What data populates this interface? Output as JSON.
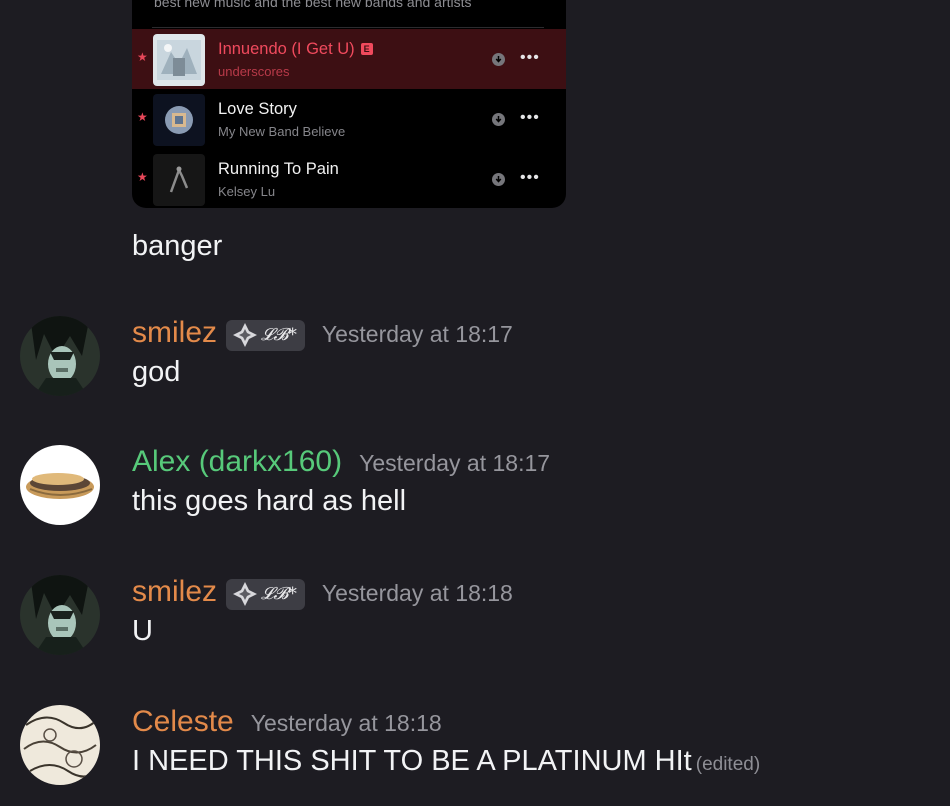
{
  "embed": {
    "description": "best new music and the best new bands and artists",
    "tracks": [
      {
        "title": "Innuendo (I Get U)",
        "artist": "underscores",
        "explicit": "E",
        "highlighted": true
      },
      {
        "title": "Love Story",
        "artist": "My New Band Believe",
        "highlighted": false
      },
      {
        "title": "Running To Pain",
        "artist": "Kelsey Lu",
        "highlighted": false
      }
    ],
    "icons": [
      "star-icon",
      "download-icon",
      "more-options-icon"
    ],
    "star_glyph": "★",
    "more_glyph": "•••"
  },
  "continuation_text": "banger",
  "messages": [
    {
      "username": "smilez",
      "username_color": "#e38a4a",
      "role_tag": "𝓛𝓑*",
      "timestamp": "Yesterday at 18:17",
      "text": "god"
    },
    {
      "username": "Alex (darkx160)",
      "username_color": "#57c97a",
      "timestamp": "Yesterday at 18:17",
      "text": "this goes hard as hell"
    },
    {
      "username": "smilez",
      "username_color": "#e38a4a",
      "role_tag": "𝓛𝓑*",
      "timestamp": "Yesterday at 18:18",
      "text": "U"
    },
    {
      "username": "Celeste",
      "username_color": "#e38a4a",
      "timestamp": "Yesterday at 18:18",
      "text": "I NEED THIS SHIT TO BE A PLATINUM HIt",
      "edited_label": "(edited)"
    }
  ]
}
